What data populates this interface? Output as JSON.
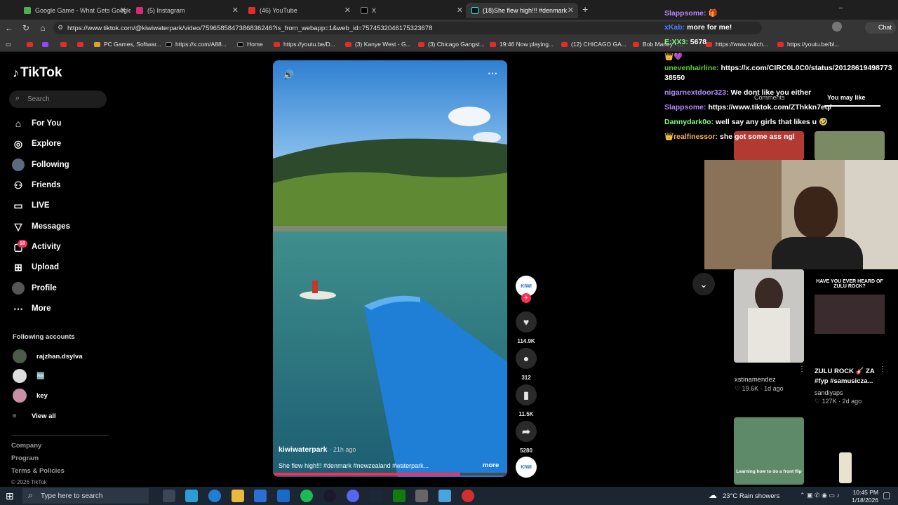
{
  "tabs": [
    {
      "label": "Google Game - What Gets Google"
    },
    {
      "label": "(5) Instagram"
    },
    {
      "label": "(46) YouTube"
    },
    {
      "label": "X"
    },
    {
      "label": "(18)She flew high!!! #denmark"
    }
  ],
  "address": {
    "url": "https://www.tiktok.com/@kiwiwaterpark/video/7596585847386836246?is_from_webapp=1&web_id=7574532046175323678"
  },
  "bookmarks": [
    "PC Games, Softwar...",
    "https://x.com/A88...",
    "Home",
    "https://youtu.be/D...",
    "(3) Kanye West - G...",
    "(3) Chicago Gangst...",
    "19:46 Now playing...",
    "(12) CHICAGO GA...",
    "Bob Marley - ...",
    "https://www.twitch...",
    "https://youtu.be/bl..."
  ],
  "brand": {
    "name": "TikTok"
  },
  "search": {
    "placeholder": "Search"
  },
  "nav": [
    {
      "label": "For You",
      "icon": "home-icon"
    },
    {
      "label": "Explore",
      "icon": "compass-icon"
    },
    {
      "label": "Following",
      "icon": "following-icon"
    },
    {
      "label": "Friends",
      "icon": "friends-icon"
    },
    {
      "label": "LIVE",
      "icon": "live-icon"
    },
    {
      "label": "Messages",
      "icon": "messages-icon"
    },
    {
      "label": "Activity",
      "icon": "activity-icon",
      "badge": "18"
    },
    {
      "label": "Upload",
      "icon": "upload-icon"
    },
    {
      "label": "Profile",
      "icon": "profile-icon"
    },
    {
      "label": "More",
      "icon": "more-icon"
    }
  ],
  "following": {
    "title": "Following accounts",
    "accounts": [
      "rajzhan.dsylva",
      "🆓",
      "key"
    ],
    "view_all": "View all"
  },
  "footer": {
    "company": "Company",
    "program": "Program",
    "terms": "Terms & Policies",
    "copyright": "© 2026 TikTok"
  },
  "video": {
    "author": "kiwiwaterpark",
    "time": "· 21h ago",
    "caption": "She flew high!!! #denmark #newzealand #waterpark...",
    "more": "more",
    "progress": 0.8
  },
  "actions": {
    "likes": "114.9K",
    "comments": "312",
    "saves": "11.5K",
    "shares": "5280"
  },
  "chat": [
    {
      "user": "Slappsome:",
      "msg": "🎁",
      "color": "#b388ff"
    },
    {
      "user": "xKab:",
      "msg": "more for me!",
      "color": "#4f7dff"
    },
    {
      "user": "E:XX3:",
      "msg": "5678",
      "color": "#7fff7f"
    },
    {
      "user": "",
      "msg": "👑💜",
      "color": "#ffffff"
    },
    {
      "user": "unevenhairline:",
      "msg": "https://x.com/CIRC0L0C0/status/2012861949877338550",
      "color": "#66cc33"
    },
    {
      "user": "nigarnextdoor323:",
      "msg": "We dont like you either",
      "color": "#b388ff"
    },
    {
      "user": "Slappsome:",
      "msg": "https://www.tiktok.com/ZThkkn7eq/",
      "color": "#b388ff"
    },
    {
      "user": "Dannydark0o:",
      "msg": "well say any girls that likes u 🤣",
      "color": "#7fff7f"
    },
    {
      "user": "👑realfinessor:",
      "msg": "she got some ass ngl",
      "color": "#ffb347"
    }
  ],
  "side_tabs": {
    "comments": "Comments",
    "may_like": "You may like"
  },
  "suggestions": [
    {
      "title": "xstinamendez",
      "likes": "19.6K",
      "age": "1d ago"
    },
    {
      "title": "ZULU ROCK 🎸 ZA #fyp #samusicza...",
      "user": "sandiyaps",
      "likes": "127K",
      "age": "2d ago",
      "overlay": "HAVE YOU EVER HEARD OF ZULU ROCK?"
    },
    {
      "overlay": "Learning how to do a front flip"
    }
  ],
  "taskbar": {
    "search_placeholder": "Type here to search",
    "weather": "23°C  Rain showers",
    "time": "10:45 PM",
    "date": "1/18/2026"
  }
}
